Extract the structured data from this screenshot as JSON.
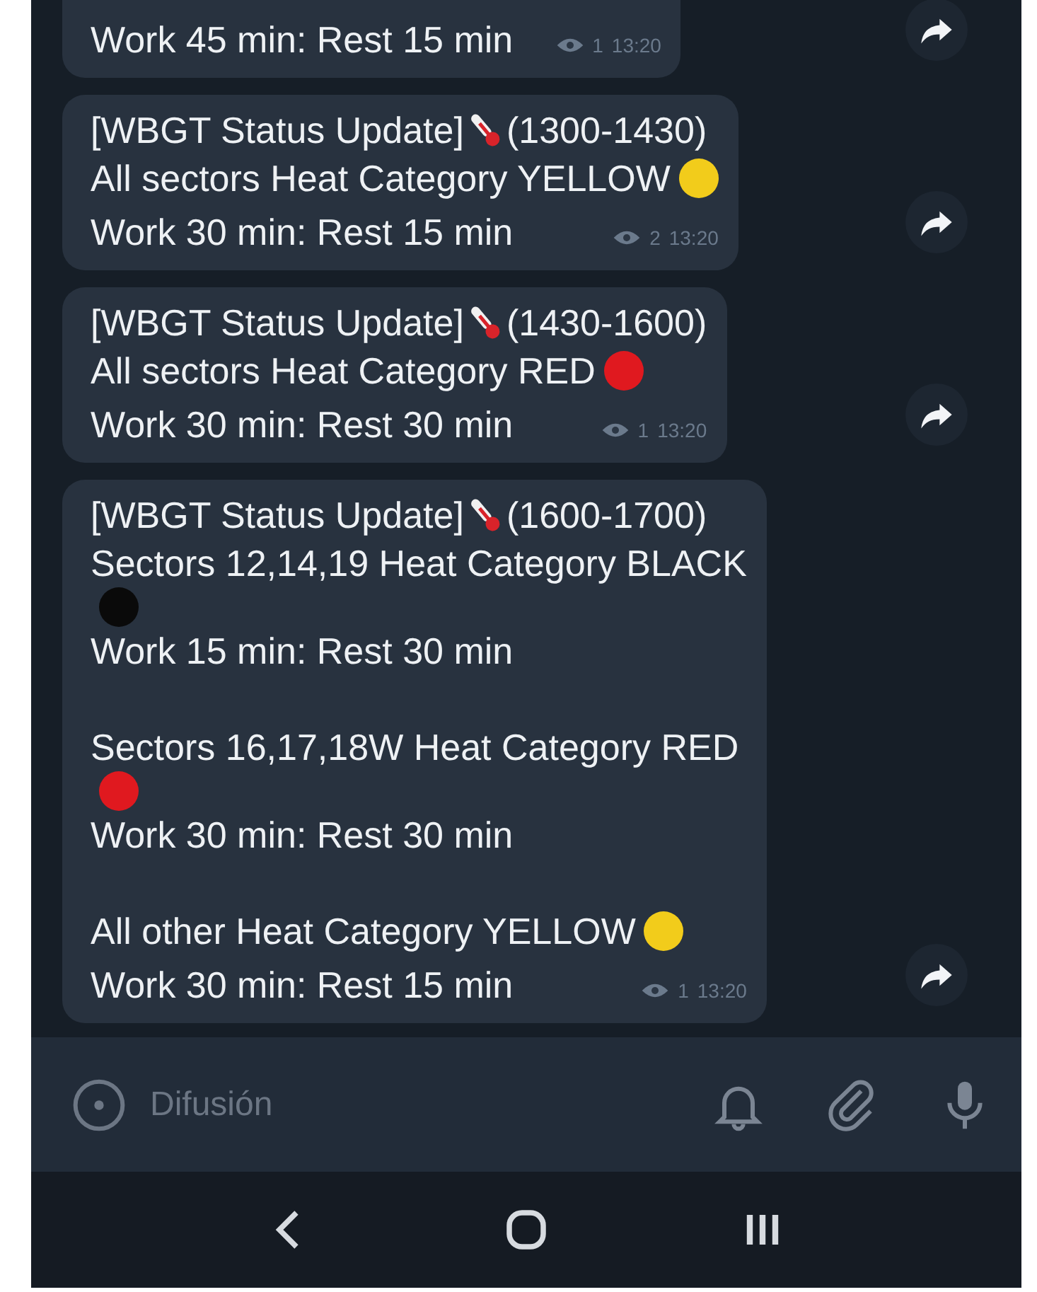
{
  "messages": [
    {
      "lines": [
        {
          "text": "Work 45 min: Rest 15 min"
        }
      ],
      "views": "1",
      "time": "13:20"
    },
    {
      "heading": {
        "before": "[WBGT Status Update]",
        "after": "(1300-1430)"
      },
      "lines": [
        {
          "text": "All sectors Heat Category YELLOW",
          "color": "#f2cc1b"
        },
        {
          "text": "Work 30 min: Rest 15 min"
        }
      ],
      "views": "2",
      "time": "13:20"
    },
    {
      "heading": {
        "before": "[WBGT Status Update]",
        "after": "(1430-1600)"
      },
      "lines": [
        {
          "text": "All sectors Heat Category RED",
          "color": "#e0191f"
        },
        {
          "text": "Work 30 min: Rest 30 min"
        }
      ],
      "views": "1",
      "time": "13:20"
    },
    {
      "heading": {
        "before": "[WBGT Status Update]",
        "after": "(1600-1700)"
      },
      "lines": [
        {
          "text": "Sectors 12,14,19 Heat Category BLACK"
        },
        {
          "color": "#0a0a0a"
        },
        {
          "text": "Work 15 min: Rest 30 min",
          "gap": true
        },
        {
          "text": "Sectors 16,17,18W Heat Category RED"
        },
        {
          "color": "#e0191f"
        },
        {
          "text": "Work 30 min: Rest 30 min",
          "gap": true
        },
        {
          "text": "All other Heat Category YELLOW",
          "color": "#f2cc1b"
        },
        {
          "text": "Work 30 min: Rest 15 min"
        }
      ],
      "views": "1",
      "time": "13:20"
    }
  ],
  "composer": {
    "placeholder": "Difusión"
  }
}
